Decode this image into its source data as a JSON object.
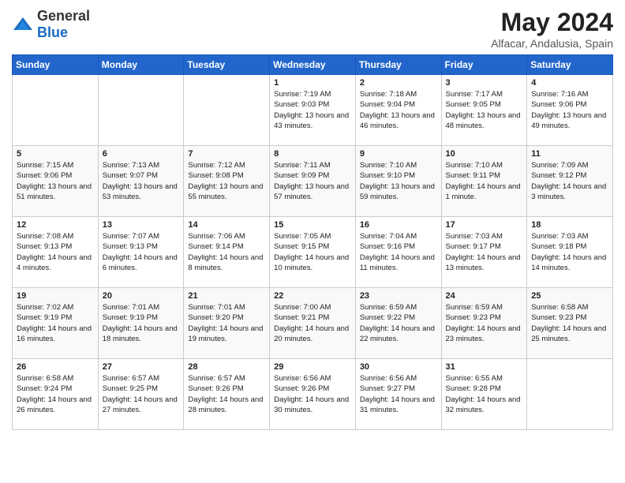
{
  "header": {
    "logo_general": "General",
    "logo_blue": "Blue",
    "title": "May 2024",
    "subtitle": "Alfacar, Andalusia, Spain"
  },
  "weekdays": [
    "Sunday",
    "Monday",
    "Tuesday",
    "Wednesday",
    "Thursday",
    "Friday",
    "Saturday"
  ],
  "weeks": [
    [
      {
        "day": "",
        "info": ""
      },
      {
        "day": "",
        "info": ""
      },
      {
        "day": "",
        "info": ""
      },
      {
        "day": "1",
        "info": "Sunrise: 7:19 AM\nSunset: 9:03 PM\nDaylight: 13 hours\nand 43 minutes."
      },
      {
        "day": "2",
        "info": "Sunrise: 7:18 AM\nSunset: 9:04 PM\nDaylight: 13 hours\nand 46 minutes."
      },
      {
        "day": "3",
        "info": "Sunrise: 7:17 AM\nSunset: 9:05 PM\nDaylight: 13 hours\nand 48 minutes."
      },
      {
        "day": "4",
        "info": "Sunrise: 7:16 AM\nSunset: 9:06 PM\nDaylight: 13 hours\nand 49 minutes."
      }
    ],
    [
      {
        "day": "5",
        "info": "Sunrise: 7:15 AM\nSunset: 9:06 PM\nDaylight: 13 hours\nand 51 minutes."
      },
      {
        "day": "6",
        "info": "Sunrise: 7:13 AM\nSunset: 9:07 PM\nDaylight: 13 hours\nand 53 minutes."
      },
      {
        "day": "7",
        "info": "Sunrise: 7:12 AM\nSunset: 9:08 PM\nDaylight: 13 hours\nand 55 minutes."
      },
      {
        "day": "8",
        "info": "Sunrise: 7:11 AM\nSunset: 9:09 PM\nDaylight: 13 hours\nand 57 minutes."
      },
      {
        "day": "9",
        "info": "Sunrise: 7:10 AM\nSunset: 9:10 PM\nDaylight: 13 hours\nand 59 minutes."
      },
      {
        "day": "10",
        "info": "Sunrise: 7:10 AM\nSunset: 9:11 PM\nDaylight: 14 hours\nand 1 minute."
      },
      {
        "day": "11",
        "info": "Sunrise: 7:09 AM\nSunset: 9:12 PM\nDaylight: 14 hours\nand 3 minutes."
      }
    ],
    [
      {
        "day": "12",
        "info": "Sunrise: 7:08 AM\nSunset: 9:13 PM\nDaylight: 14 hours\nand 4 minutes."
      },
      {
        "day": "13",
        "info": "Sunrise: 7:07 AM\nSunset: 9:13 PM\nDaylight: 14 hours\nand 6 minutes."
      },
      {
        "day": "14",
        "info": "Sunrise: 7:06 AM\nSunset: 9:14 PM\nDaylight: 14 hours\nand 8 minutes."
      },
      {
        "day": "15",
        "info": "Sunrise: 7:05 AM\nSunset: 9:15 PM\nDaylight: 14 hours\nand 10 minutes."
      },
      {
        "day": "16",
        "info": "Sunrise: 7:04 AM\nSunset: 9:16 PM\nDaylight: 14 hours\nand 11 minutes."
      },
      {
        "day": "17",
        "info": "Sunrise: 7:03 AM\nSunset: 9:17 PM\nDaylight: 14 hours\nand 13 minutes."
      },
      {
        "day": "18",
        "info": "Sunrise: 7:03 AM\nSunset: 9:18 PM\nDaylight: 14 hours\nand 14 minutes."
      }
    ],
    [
      {
        "day": "19",
        "info": "Sunrise: 7:02 AM\nSunset: 9:19 PM\nDaylight: 14 hours\nand 16 minutes."
      },
      {
        "day": "20",
        "info": "Sunrise: 7:01 AM\nSunset: 9:19 PM\nDaylight: 14 hours\nand 18 minutes."
      },
      {
        "day": "21",
        "info": "Sunrise: 7:01 AM\nSunset: 9:20 PM\nDaylight: 14 hours\nand 19 minutes."
      },
      {
        "day": "22",
        "info": "Sunrise: 7:00 AM\nSunset: 9:21 PM\nDaylight: 14 hours\nand 20 minutes."
      },
      {
        "day": "23",
        "info": "Sunrise: 6:59 AM\nSunset: 9:22 PM\nDaylight: 14 hours\nand 22 minutes."
      },
      {
        "day": "24",
        "info": "Sunrise: 6:59 AM\nSunset: 9:23 PM\nDaylight: 14 hours\nand 23 minutes."
      },
      {
        "day": "25",
        "info": "Sunrise: 6:58 AM\nSunset: 9:23 PM\nDaylight: 14 hours\nand 25 minutes."
      }
    ],
    [
      {
        "day": "26",
        "info": "Sunrise: 6:58 AM\nSunset: 9:24 PM\nDaylight: 14 hours\nand 26 minutes."
      },
      {
        "day": "27",
        "info": "Sunrise: 6:57 AM\nSunset: 9:25 PM\nDaylight: 14 hours\nand 27 minutes."
      },
      {
        "day": "28",
        "info": "Sunrise: 6:57 AM\nSunset: 9:26 PM\nDaylight: 14 hours\nand 28 minutes."
      },
      {
        "day": "29",
        "info": "Sunrise: 6:56 AM\nSunset: 9:26 PM\nDaylight: 14 hours\nand 30 minutes."
      },
      {
        "day": "30",
        "info": "Sunrise: 6:56 AM\nSunset: 9:27 PM\nDaylight: 14 hours\nand 31 minutes."
      },
      {
        "day": "31",
        "info": "Sunrise: 6:55 AM\nSunset: 9:28 PM\nDaylight: 14 hours\nand 32 minutes."
      },
      {
        "day": "",
        "info": ""
      }
    ]
  ]
}
